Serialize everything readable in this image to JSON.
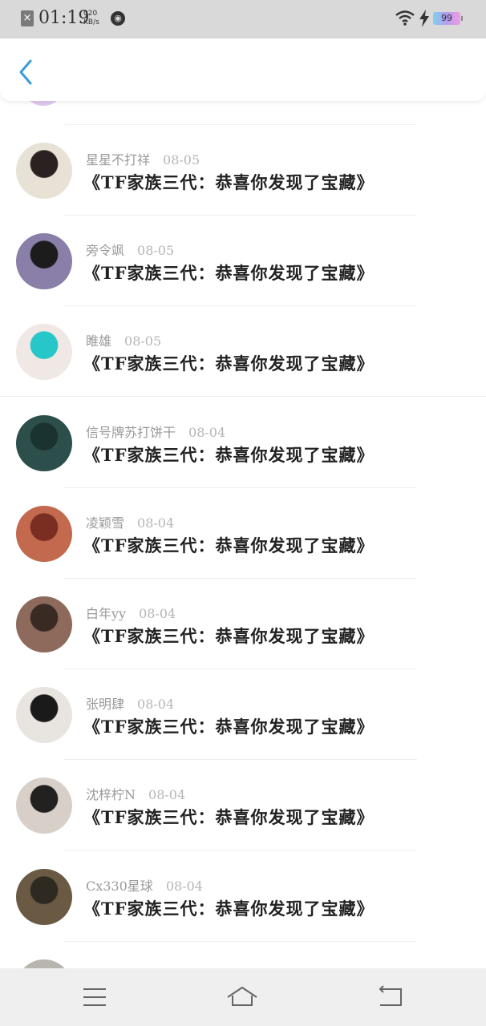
{
  "status_bar": {
    "time": "01:19",
    "speed_value": "020",
    "speed_unit": "KB/s",
    "battery": "99"
  },
  "items": [
    {
      "name": "星星不打祥",
      "date": "08-05",
      "title": "《TF家族三代：恭喜你发现了宝藏》",
      "avatar_colors": [
        "#e8e2d6",
        "#2a2220"
      ]
    },
    {
      "name": "旁令飒",
      "date": "08-05",
      "title": "《TF家族三代：恭喜你发现了宝藏》",
      "avatar_colors": [
        "#8a7fa8",
        "#1c1c1c"
      ]
    },
    {
      "name": "睢雄",
      "date": "08-05",
      "title": "《TF家族三代：恭喜你发现了宝藏》",
      "avatar_colors": [
        "#f0e8e4",
        "#27c6c8"
      ]
    },
    {
      "name": "信号牌苏打饼干",
      "date": "08-04",
      "title": "《TF家族三代：恭喜你发现了宝藏》",
      "avatar_colors": [
        "#2d4f4c",
        "#1a3330"
      ]
    },
    {
      "name": "凌颖雪",
      "date": "08-04",
      "title": "《TF家族三代：恭喜你发现了宝藏》",
      "avatar_colors": [
        "#c2694e",
        "#7a2e22"
      ]
    },
    {
      "name": "白年yy",
      "date": "08-04",
      "title": "《TF家族三代：恭喜你发现了宝藏》",
      "avatar_colors": [
        "#8e6a5c",
        "#3a2a24"
      ]
    },
    {
      "name": "张明肆",
      "date": "08-04",
      "title": "《TF家族三代：恭喜你发现了宝藏》",
      "avatar_colors": [
        "#e8e4e0",
        "#1a1a1a"
      ]
    },
    {
      "name": "沈梓柠N",
      "date": "08-04",
      "title": "《TF家族三代：恭喜你发现了宝藏》",
      "avatar_colors": [
        "#d8d0c8",
        "#232020"
      ]
    },
    {
      "name": "Cx330星球",
      "date": "08-04",
      "title": "《TF家族三代：恭喜你发现了宝藏》",
      "avatar_colors": [
        "#6a5a44",
        "#2e2a22"
      ]
    }
  ],
  "colors": {
    "accent": "#3a9bdc",
    "status_bar_bg": "#d9d9d9",
    "nav_bar_bg": "#efefef"
  },
  "icons": {
    "back": "chevron-left-icon",
    "menu": "menu-icon",
    "home": "home-icon",
    "return": "return-icon"
  }
}
